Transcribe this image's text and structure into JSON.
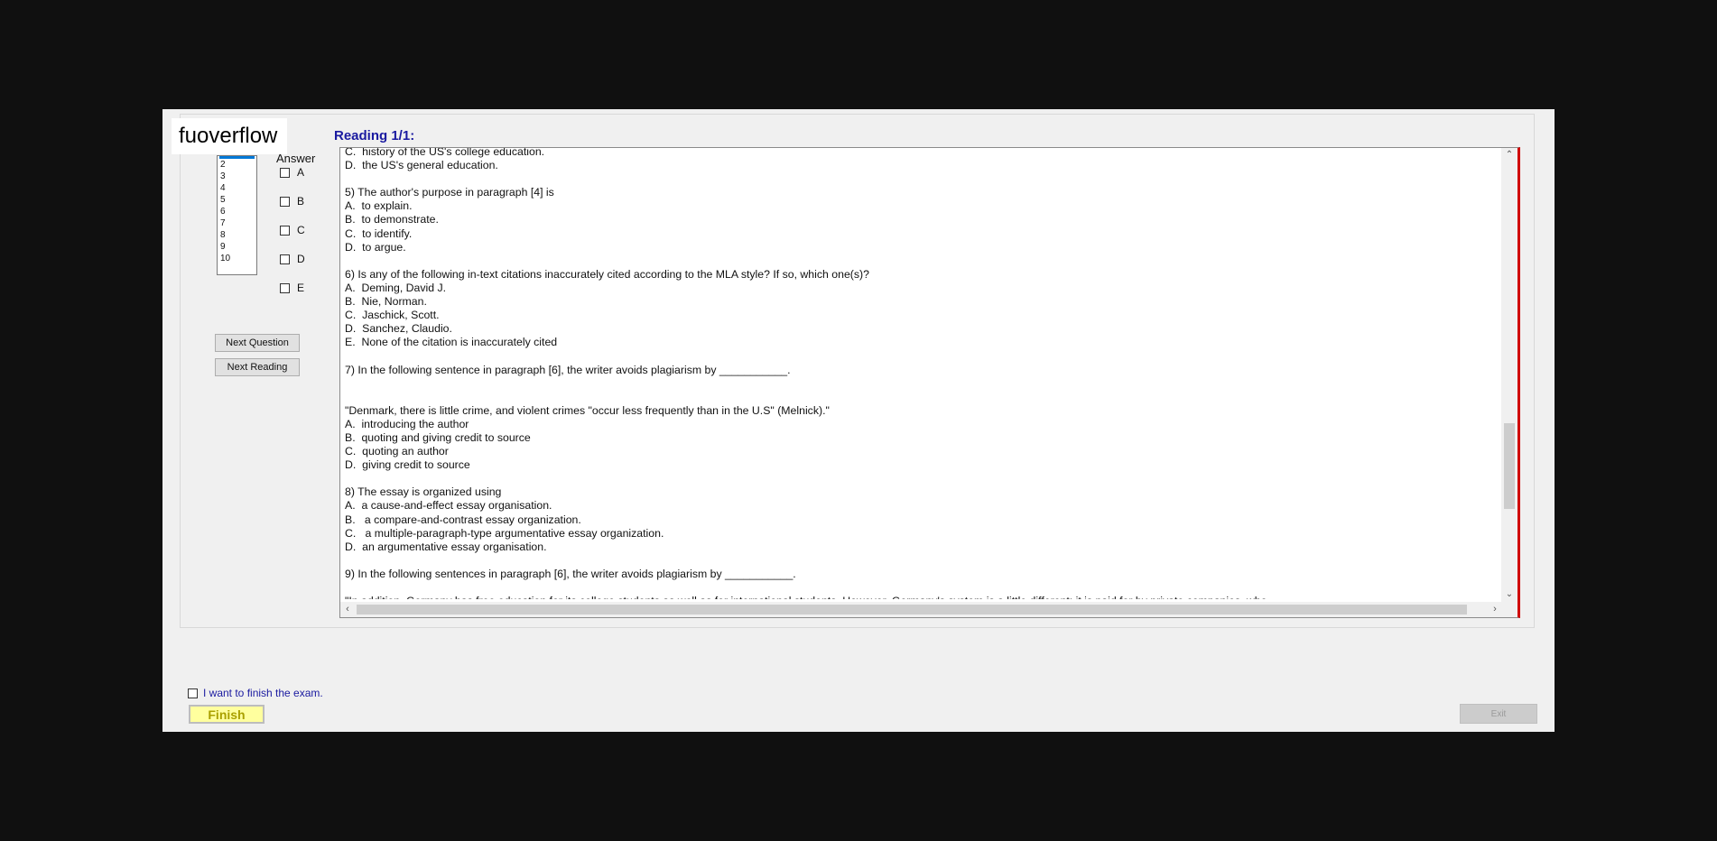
{
  "watermark": "fuoverflow",
  "sidebar": {
    "answer_label": "Answer",
    "question_list": [
      "2",
      "3",
      "4",
      "5",
      "6",
      "7",
      "8",
      "9",
      "10"
    ],
    "choices": [
      "A",
      "B",
      "C",
      "D",
      "E"
    ],
    "next_question_label": "Next Question",
    "next_reading_label": "Next Reading"
  },
  "reading": {
    "title": "Reading 1/1:",
    "lines": [
      "C.  history of the US's college education.",
      "D.  the US's general education.",
      "",
      "5) The author's purpose in paragraph [4] is",
      "A.  to explain.",
      "B.  to demonstrate.",
      "C.  to identify.",
      "D.  to argue.",
      "",
      "6) Is any of the following in-text citations inaccurately cited according to the MLA style? If so, which one(s)?",
      "A.  Deming, David J.",
      "B.  Nie, Norman.",
      "C.  Jaschick, Scott.",
      "D.  Sanchez, Claudio.",
      "E.  None of the citation is inaccurately cited",
      "",
      "7) In the following sentence in paragraph [6], the writer avoids plagiarism by ___________.",
      "",
      "",
      "\"Denmark, there is little crime, and violent crimes \"occur less frequently than in the U.S\" (Melnick).\"",
      "A.  introducing the author",
      "B.  quoting and giving credit to source",
      "C.  quoting an author",
      "D.  giving credit to source",
      "",
      "8) The essay is organized using",
      "A.  a cause-and-effect essay organisation.",
      "B.   a compare-and-contrast essay organization.",
      "C.   a multiple-paragraph-type argumentative essay organization.",
      "D.  an argumentative essay organisation.",
      "",
      "9) In the following sentences in paragraph [6], the writer avoids plagiarism by ___________.",
      "",
      "\"In addition, Germany has free education for its college students as well as for international students. However, Germany's system is a little different; it is paid for by private companies, who"
    ]
  },
  "footer": {
    "finish_checkbox_label": "I want to finish the exam.",
    "finish_label": "Finish",
    "exit_label": "Exit"
  }
}
